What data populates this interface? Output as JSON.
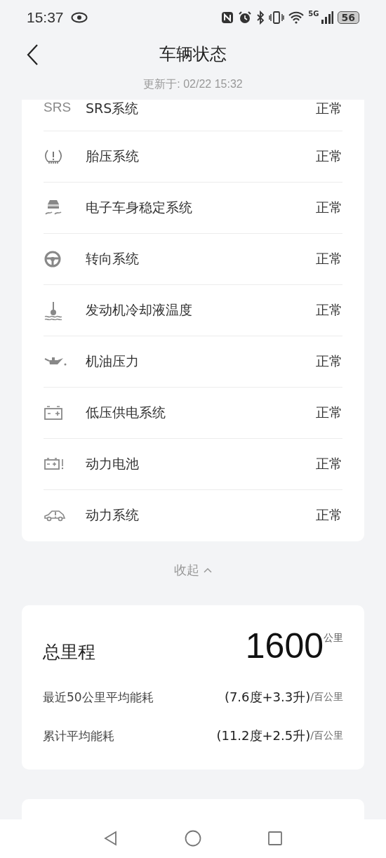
{
  "status_bar": {
    "time": "15:37",
    "network": "5G",
    "battery": "56"
  },
  "header": {
    "title": "车辆状态",
    "updated": "更新于: 02/22 15:32"
  },
  "systems": [
    {
      "kind": "srs",
      "icon_text": "SRS",
      "name": "SRS系统",
      "status": "正常"
    },
    {
      "kind": "tire",
      "name": "胎压系统",
      "status": "正常"
    },
    {
      "kind": "esc",
      "name": "电子车身稳定系统",
      "status": "正常"
    },
    {
      "kind": "steering",
      "name": "转向系统",
      "status": "正常"
    },
    {
      "kind": "coolant",
      "name": "发动机冷却液温度",
      "status": "正常"
    },
    {
      "kind": "oil",
      "name": "机油压力",
      "status": "正常"
    },
    {
      "kind": "battery",
      "name": "低压供电系统",
      "status": "正常"
    },
    {
      "kind": "power_battery",
      "name": "动力电池",
      "status": "正常"
    },
    {
      "kind": "powertrain",
      "name": "动力系统",
      "status": "正常"
    }
  ],
  "collapse": {
    "label": "收起"
  },
  "mileage": {
    "label": "总里程",
    "value": "1600",
    "unit": "公里",
    "rows": [
      {
        "label": "最近50公里平均能耗",
        "value": "(7.6度+3.3升)",
        "unit": "/百公里"
      },
      {
        "label": "累计平均能耗",
        "value": "(11.2度+2.5升)",
        "unit": "/百公里"
      }
    ]
  }
}
